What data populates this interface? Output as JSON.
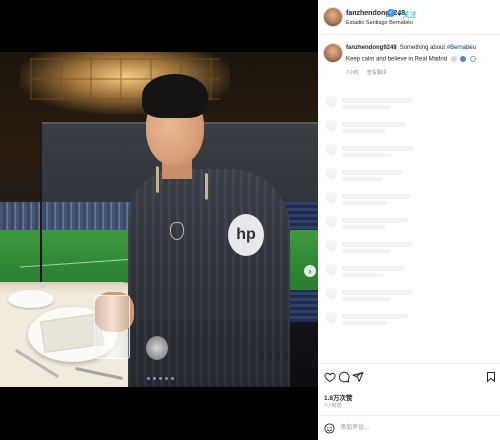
{
  "header": {
    "username": "fanzhendong9248",
    "verified_badge": "✓",
    "separator": "•",
    "follow_label": "关注",
    "location": "Estadio Santiago Bernabéu"
  },
  "caption": {
    "username": "fanzhendong9248",
    "text_prefix": "Something about ",
    "hashtag": "#Bernabeu",
    "line2": "Keep calm and believe in Real Madrid",
    "age": "7小时",
    "translate_label": "查看翻译"
  },
  "media": {
    "jersey_sponsor": "hp",
    "next_icon": "›",
    "slide_count": 5,
    "active_slide": 0
  },
  "actions": {
    "icons": [
      "heart-icon",
      "comment-icon",
      "share-icon",
      "bookmark-icon"
    ]
  },
  "stats": {
    "likes": "1.8万次赞",
    "posted": "7小时前"
  },
  "comment": {
    "placeholder": "添加评论..."
  },
  "colors": {
    "link_blue": "#0095f6",
    "hashtag_blue": "#00376b",
    "meta_gray": "#8e8e8e"
  }
}
